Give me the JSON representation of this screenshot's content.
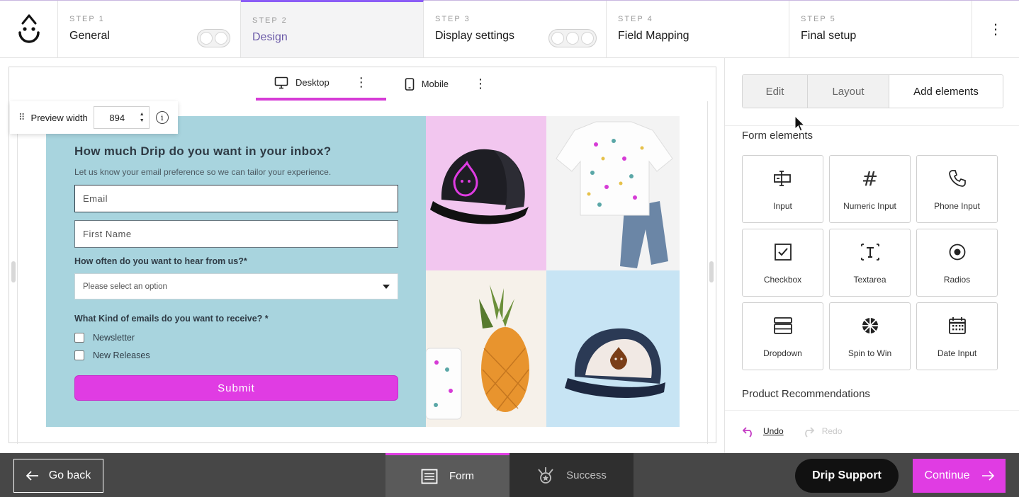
{
  "steps": [
    {
      "num": "STEP 1",
      "name": "General"
    },
    {
      "num": "STEP 2",
      "name": "Design"
    },
    {
      "num": "STEP 3",
      "name": "Display settings"
    },
    {
      "num": "STEP 4",
      "name": "Field Mapping"
    },
    {
      "num": "STEP 5",
      "name": "Final setup"
    }
  ],
  "canvas": {
    "tabs": {
      "desktop": "Desktop",
      "mobile": "Mobile"
    },
    "preview_width_label": "Preview width",
    "preview_width_value": "894"
  },
  "form": {
    "title": "How much Drip do you want in your inbox?",
    "subtitle": "Let us know your email preference so we can tailor your experience.",
    "email_placeholder": "Email",
    "first_name_placeholder": "First Name",
    "frequency_question": "How often do you want to hear from us?*",
    "select_placeholder": "Please select an option",
    "email_types_question": "What Kind of emails do you want to receive? *",
    "options": [
      "Newsletter",
      "New Releases"
    ],
    "submit_label": "Submit"
  },
  "panel": {
    "tabs": [
      "Edit",
      "Layout",
      "Add elements"
    ],
    "form_elements_heading": "Form elements",
    "elements": [
      {
        "label": "Input",
        "icon": "input-icon"
      },
      {
        "label": "Numeric Input",
        "icon": "hash-icon"
      },
      {
        "label": "Phone Input",
        "icon": "phone-icon"
      },
      {
        "label": "Checkbox",
        "icon": "checkbox-icon"
      },
      {
        "label": "Textarea",
        "icon": "textarea-icon"
      },
      {
        "label": "Radios",
        "icon": "radio-icon"
      },
      {
        "label": "Dropdown",
        "icon": "dropdown-icon"
      },
      {
        "label": "Spin to Win",
        "icon": "wheel-icon"
      },
      {
        "label": "Date Input",
        "icon": "calendar-icon"
      }
    ],
    "product_heading": "Product Recommendations",
    "undo": "Undo",
    "redo": "Redo"
  },
  "bottom": {
    "go_back": "Go back",
    "tabs": {
      "form": "Form",
      "success": "Success"
    },
    "support": "Drip Support",
    "continue": "Continue"
  },
  "colors": {
    "accent": "#e03ce3",
    "form_bg": "#a8d4de",
    "step_active": "#8b5cf6"
  }
}
